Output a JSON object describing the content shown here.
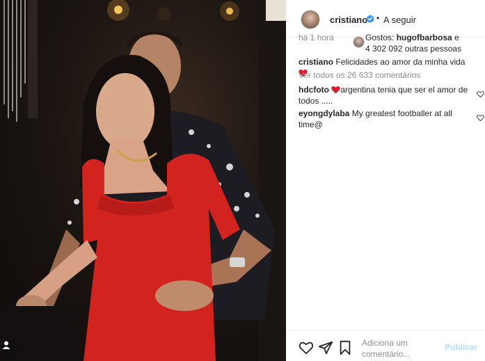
{
  "post": {
    "username": "cristiano",
    "follow_dot": "•",
    "follow_label": "A seguir",
    "time_ago": "há 1 hora",
    "likes": {
      "prefix": "Gostos: ",
      "liked_by": "hugofbarbosa",
      "connector": " e",
      "others": "4 302 092 outras pessoas"
    },
    "caption": {
      "user": "cristiano",
      "text": "Felicidades ao amor da minha vida"
    },
    "view_all": "Ver todos os 26 633 comentários",
    "comments": [
      {
        "user": "hdcfoto",
        "text": "argentina tenia que ser el amor de todos ....."
      },
      {
        "user": "eyongdylaba",
        "text": "My greatest footballer at all time@"
      }
    ],
    "add_comment_placeholder": "Adiciona um comentário...",
    "publish_label": "Publicar"
  },
  "colors": {
    "heart": "#ed4956",
    "verified": "#3897f0",
    "publish": "#b2dffc",
    "muted": "#8e8e8e"
  },
  "icons": [
    "verified-badge-icon",
    "heart-icon",
    "share-icon",
    "bookmark-icon",
    "user-tag-icon"
  ]
}
